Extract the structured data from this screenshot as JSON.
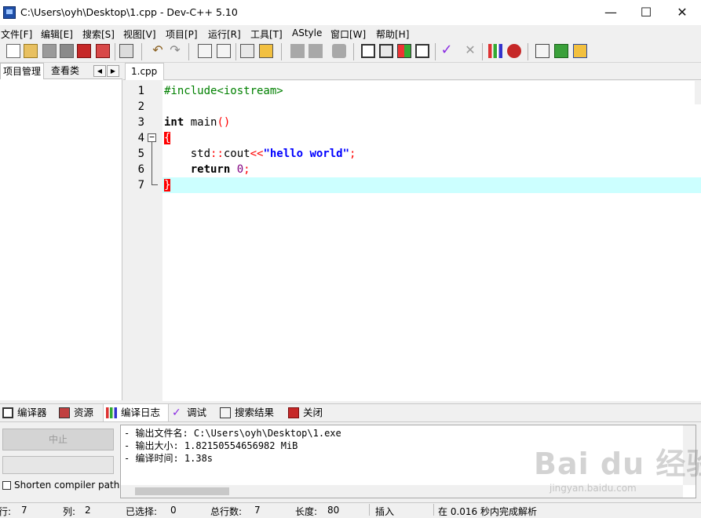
{
  "window": {
    "title": "C:\\Users\\oyh\\Desktop\\1.cpp - Dev-C++ 5.10",
    "min_icon": "minimize-icon",
    "max_icon": "maximize-icon",
    "close_icon": "close-icon",
    "min_glyph": "—",
    "max_glyph": "☐",
    "close_glyph": "✕"
  },
  "menu": [
    "文件[F]",
    "编辑[E]",
    "搜索[S]",
    "视图[V]",
    "项目[P]",
    "运行[R]",
    "工具[T]",
    "AStyle",
    "窗口[W]",
    "帮助[H]"
  ],
  "left_panel": {
    "tabs": [
      "项目管理",
      "查看类"
    ],
    "prev_glyph": "◀",
    "next_glyph": "▶"
  },
  "editor": {
    "tab_label": "1.cpp",
    "fold_glyph": "−",
    "line_numbers": [
      "1",
      "2",
      "3",
      "4",
      "5",
      "6",
      "7"
    ],
    "lines": {
      "l1": "#include<iostream>",
      "l3_kw": "int",
      "l3_name": " main",
      "l3_parens": "()",
      "l4": "{",
      "l5_indent": "    ",
      "l5_ns": "std",
      "l5_scope": "::",
      "l5_name": "cout",
      "l5_op": "<<",
      "l5_str": "\"hello world\"",
      "l5_semi": ";",
      "l6_indent": "    ",
      "l6_kw": "return",
      "l6_space": " ",
      "l6_num": "0",
      "l6_semi": ";",
      "l7": "}"
    }
  },
  "bottom_tabs": [
    {
      "label": "编译器",
      "icon": "compiler-grid-icon"
    },
    {
      "label": "资源",
      "icon": "resources-icon"
    },
    {
      "label": "编译日志",
      "icon": "compile-log-chart-icon"
    },
    {
      "label": "调试",
      "icon": "debug-check-icon"
    },
    {
      "label": "搜索结果",
      "icon": "search-results-icon"
    },
    {
      "label": "关闭",
      "icon": "close-panel-icon"
    }
  ],
  "compiler_panel": {
    "stop_label": "中止",
    "shorten_label": "Shorten compiler paths",
    "shorten_checked": false
  },
  "log": [
    "- 输出文件名: C:\\Users\\oyh\\Desktop\\1.exe",
    "- 输出大小: 1.82150554656982 MiB",
    "- 编译时间: 1.38s"
  ],
  "status": {
    "row_label": "行:",
    "row_value": "7",
    "col_label": "列:",
    "col_value": "2",
    "sel_label": "已选择:",
    "sel_value": "0",
    "total_label": "总行数:",
    "total_value": "7",
    "len_label": "长度:",
    "len_value": "80",
    "mode": "插入",
    "parse_msg": "在 0.016 秒内完成解析"
  },
  "watermark": {
    "text": "Bai du 经验",
    "sub": "jingyan.baidu.com"
  },
  "colors": {
    "current_line": "#ccffff",
    "preprocessor": "#008000",
    "string": "#0000ff",
    "symbol": "#ff0000",
    "number": "#800080"
  }
}
